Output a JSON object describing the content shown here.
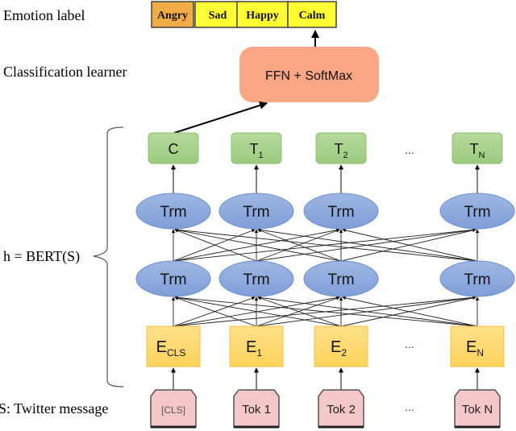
{
  "side_labels": {
    "emotion": "Emotion label",
    "classification": "Classification learner",
    "bert": "h = BERT(S)",
    "input": "S: Twitter message"
  },
  "emotions": [
    {
      "label": "Angry",
      "color": "#f0ad45"
    },
    {
      "label": "Sad",
      "color": "#ffff33"
    },
    {
      "label": "Happy",
      "color": "#ffff33"
    },
    {
      "label": "Calm",
      "color": "#ffff33"
    }
  ],
  "classifier": {
    "label": "FFN + SoftMax",
    "color": "#fba786"
  },
  "outputs": [
    {
      "main": "C",
      "sub": ""
    },
    {
      "main": "T",
      "sub": "1"
    },
    {
      "main": "T",
      "sub": "2"
    },
    {
      "main": "T",
      "sub": "N"
    }
  ],
  "trm_label": "Trm",
  "embeddings": [
    {
      "main": "E",
      "sub": "CLS"
    },
    {
      "main": "E",
      "sub": "1"
    },
    {
      "main": "E",
      "sub": "2"
    },
    {
      "main": "E",
      "sub": "N"
    }
  ],
  "tokens": [
    "[CLS]",
    "Tok 1",
    "Tok 2",
    "Tok N"
  ],
  "ellipsis": "...",
  "colors": {
    "output_fill": "#a9d18e",
    "trm_fill": "#8faadc",
    "embed_fill": "#ffd966",
    "token_fill": "#f4c7c9"
  }
}
